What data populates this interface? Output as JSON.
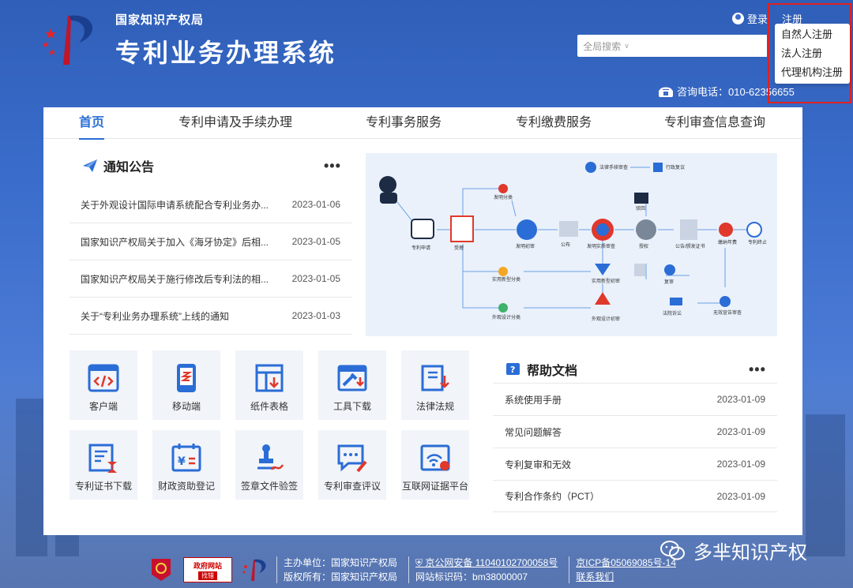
{
  "header": {
    "org_name": "国家知识产权局",
    "system_name": "专利业务办理系统",
    "login_label": "登录",
    "register_label": "注册",
    "search_scope": "全局搜索",
    "search_placeholder": "",
    "hotline": "咨询电话：010-62356655"
  },
  "register_menu": {
    "items": [
      {
        "label": "自然人注册"
      },
      {
        "label": "法人注册"
      },
      {
        "label": "代理机构注册"
      }
    ]
  },
  "nav": {
    "tabs": [
      {
        "label": "首页",
        "active": true
      },
      {
        "label": "专利申请及手续办理"
      },
      {
        "label": "专利事务服务"
      },
      {
        "label": "专利缴费服务"
      },
      {
        "label": "专利审查信息查询"
      }
    ]
  },
  "notices": {
    "title": "通知公告",
    "more": "•••",
    "items": [
      {
        "title": "关于外观设计国际申请系统配合专利业务办...",
        "date": "2023-01-06"
      },
      {
        "title": "国家知识产权局关于加入《海牙协定》后相...",
        "date": "2023-01-05"
      },
      {
        "title": "国家知识产权局关于施行修改后专利法的相...",
        "date": "2023-01-05"
      },
      {
        "title": "关于“专利业务办理系统”上线的通知",
        "date": "2023-01-03"
      }
    ]
  },
  "flowchart": {
    "nodes": [
      "专利申请",
      "受理",
      "发明初审",
      "公布",
      "发明实质审查",
      "授权",
      "公告/颁发证书",
      "缴纳年费",
      "专利终止",
      "驳回",
      "复审",
      "实用新型初审",
      "外观设计初审",
      "实用新型分类",
      "外观设计分类",
      "发明分类",
      "法律手续审查",
      "行政复议",
      "无效宣告审查",
      "法院诉讼"
    ]
  },
  "tiles": [
    {
      "label": "客户端",
      "icon": "code-window-icon"
    },
    {
      "label": "移动端",
      "icon": "mobile-icon"
    },
    {
      "label": "纸件表格",
      "icon": "form-icon"
    },
    {
      "label": "工具下载",
      "icon": "toolbox-icon"
    },
    {
      "label": "法律法规",
      "icon": "law-book-icon"
    },
    {
      "label": "专利证书下载",
      "icon": "certificate-icon"
    },
    {
      "label": "财政资助登记",
      "icon": "funding-icon"
    },
    {
      "label": "签章文件验签",
      "icon": "stamp-icon"
    },
    {
      "label": "专利审查评议",
      "icon": "comment-icon"
    },
    {
      "label": "互联网证据平台",
      "icon": "evidence-icon"
    }
  ],
  "help": {
    "title": "帮助文档",
    "more": "•••",
    "items": [
      {
        "title": "系统使用手册",
        "date": "2023-01-09"
      },
      {
        "title": "常见问题解答",
        "date": "2023-01-09"
      },
      {
        "title": "专利复审和无效",
        "date": "2023-01-09"
      },
      {
        "title": "专利合作条约（PCT）",
        "date": "2023-01-09"
      }
    ]
  },
  "footer": {
    "gov_badge_top": "政府网站",
    "gov_badge_bottom": "找错",
    "host": "主办单位：国家知识产权局",
    "copyright": "版权所有：国家知识产权局",
    "police": "京公网安备 11040102700058号",
    "site_code": "网站标识码：bm38000007",
    "icp": "京ICP备05069085号-14",
    "contact": "联系我们"
  },
  "watermark": {
    "text": "多芈知识产权"
  },
  "colors": {
    "accent": "#2a6dd6",
    "background": "#3a6ccb",
    "highlight_box": "#e02020"
  }
}
